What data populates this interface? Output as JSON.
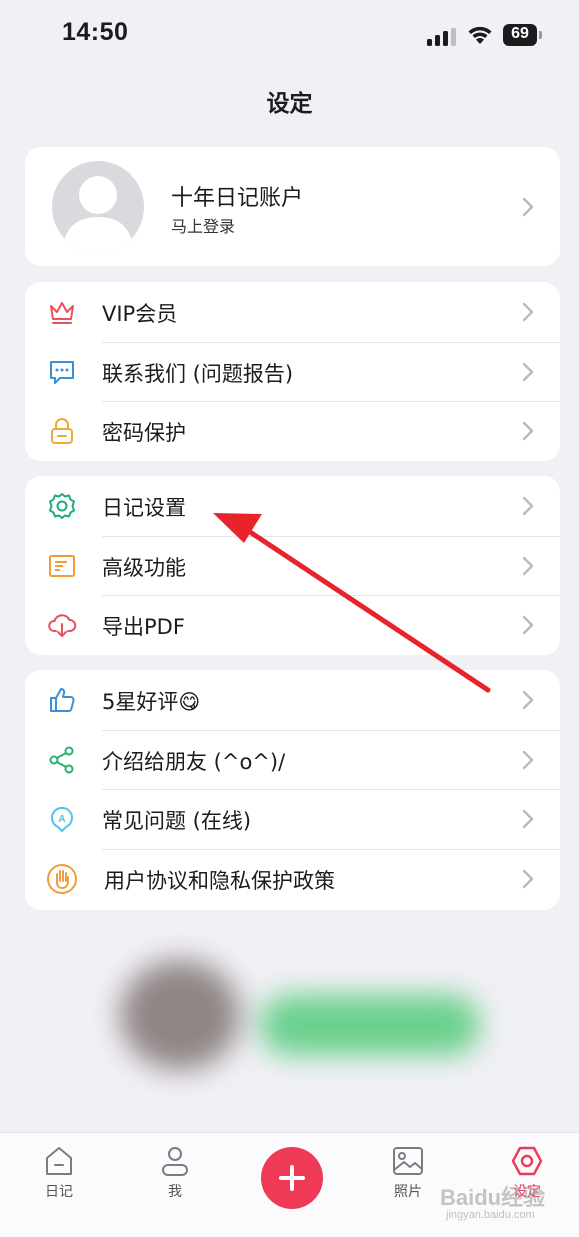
{
  "status_bar": {
    "time": "14:50",
    "battery": "69"
  },
  "page_title": "设定",
  "account": {
    "name": "十年日记账户",
    "subtitle": "马上登录"
  },
  "groups": [
    {
      "items": [
        {
          "label": "VIP会员",
          "icon": "crown-icon",
          "color": "#e8505b"
        },
        {
          "label": "联系我们 (问题报告)",
          "icon": "chat-icon",
          "color": "#3b8fd9"
        },
        {
          "label": "密码保护",
          "icon": "lock-icon",
          "color": "#f3a73a"
        }
      ]
    },
    {
      "items": [
        {
          "label": "日记设置",
          "icon": "gear-icon",
          "color": "#1fae78"
        },
        {
          "label": "高级功能",
          "icon": "document-icon",
          "color": "#f29b38"
        },
        {
          "label": "导出PDF",
          "icon": "cloud-download-icon",
          "color": "#e8505b"
        }
      ]
    },
    {
      "items": [
        {
          "label": "5星好评😋",
          "icon": "thumbs-up-icon",
          "color": "#3b8fd9"
        },
        {
          "label": "介绍给朋友 (^o^)/",
          "icon": "share-icon",
          "color": "#27b36e"
        },
        {
          "label": "常见问题 (在线)",
          "icon": "help-bubble-icon",
          "color": "#4fc3e8"
        },
        {
          "label": "用户协议和隐私保护政策",
          "icon": "hand-icon",
          "color": "#f29b38"
        }
      ]
    }
  ],
  "tab_bar": {
    "tabs": [
      {
        "label": "日记",
        "icon": "diary-icon"
      },
      {
        "label": "我",
        "icon": "person-icon"
      },
      {
        "label": "照片",
        "icon": "photo-icon"
      },
      {
        "label": "设定",
        "icon": "settings-icon",
        "active": true
      }
    ],
    "add_icon": "plus-icon"
  },
  "annotation": {
    "arrow_color": "#e8232b"
  },
  "watermark": {
    "text": "Baidu经验",
    "sub": "jingyan.baidu.com"
  }
}
